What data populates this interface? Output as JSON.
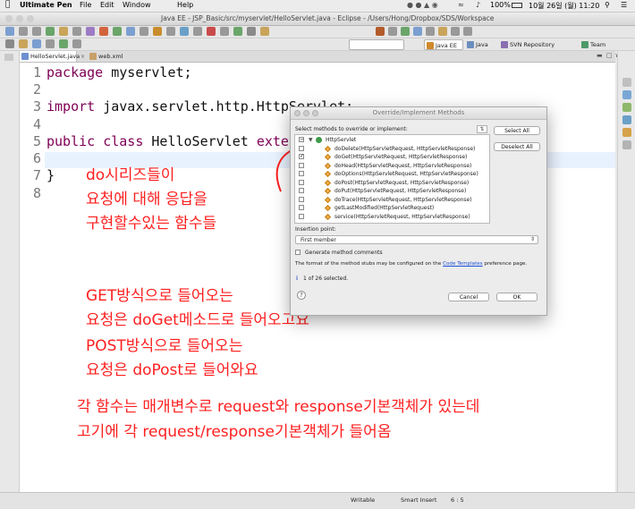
{
  "menubar": {
    "app": "Ultimate Pen",
    "items": [
      "File",
      "Edit",
      "Window",
      "Help"
    ],
    "battery": "100%",
    "clock": "10월 26일 (월) 11:20"
  },
  "window": {
    "title": "Java EE - JSP_Basic/src/myservlet/HelloServlet.java - Eclipse - /Users/Hong/Dropbox/SDS/Workspace"
  },
  "perspectives": [
    {
      "label": "Java EE",
      "color": "#d08a2c"
    },
    {
      "label": "Java",
      "color": "#6b8ebf"
    },
    {
      "label": "SVN Repository Exploring",
      "color": "#8a6fb0"
    },
    {
      "label": "Team Synchronizing",
      "color": "#4c9a6a"
    }
  ],
  "editor": {
    "tabs": [
      {
        "label": "HelloServlet.java",
        "active": true
      },
      {
        "label": "web.xml",
        "active": false
      }
    ],
    "lines": [
      {
        "num": "1",
        "text": "package myservlet;"
      },
      {
        "num": "2",
        "text": ""
      },
      {
        "num": "3",
        "text": "import javax.servlet.http.HttpServlet;"
      },
      {
        "num": "4",
        "text": ""
      },
      {
        "num": "5",
        "text": "public class HelloServlet extends HttpServlet {"
      },
      {
        "num": "6",
        "text": ""
      },
      {
        "num": "7",
        "text": "}"
      },
      {
        "num": "8",
        "text": ""
      }
    ]
  },
  "annotations": {
    "group1": [
      "do시리즈들이",
      "요청에 대해 응답을",
      "구현할수있는 함수들"
    ],
    "group2": [
      "GET방식으로 들어오는",
      "요청은 doGet메소드로 들어오고요",
      "POST방식으로 들어오는",
      "요청은 doPost로 들어와요"
    ],
    "group3": [
      "각 함수는 매개변수로 request와 response기본객체가 있는데",
      "고기에 각 request/response기본객체가 들어옴"
    ]
  },
  "dialog": {
    "title": "Override/Implement Methods",
    "prompt": "Select methods to override or implement:",
    "select_all": "Select All",
    "deselect_all": "Deselect All",
    "root": "HttpServlet",
    "methods": [
      {
        "name": "doDelete(HttpServletRequest, HttpServletResponse)",
        "checked": false
      },
      {
        "name": "doGet(HttpServletRequest, HttpServletResponse)",
        "checked": true
      },
      {
        "name": "doHead(HttpServletRequest, HttpServletResponse)",
        "checked": false
      },
      {
        "name": "doOptions(HttpServletRequest, HttpServletResponse)",
        "checked": false
      },
      {
        "name": "doPost(HttpServletRequest, HttpServletResponse)",
        "checked": false
      },
      {
        "name": "doPut(HttpServletRequest, HttpServletResponse)",
        "checked": false
      },
      {
        "name": "doTrace(HttpServletRequest, HttpServletResponse)",
        "checked": false
      },
      {
        "name": "getLastModified(HttpServletRequest)",
        "checked": false
      },
      {
        "name": "service(HttpServletRequest, HttpServletResponse)",
        "checked": false
      }
    ],
    "insertion_label": "Insertion point:",
    "insertion_value": "First member",
    "generate_comments": "Generate method comments",
    "format_prefix": "The format of the method stubs may be configured on the",
    "format_link": "Code Templates",
    "format_suffix": "preference page.",
    "selected_info": "1 of 26 selected.",
    "cancel": "Cancel",
    "ok": "OK"
  },
  "status": {
    "mode": "Writable",
    "insert": "Smart Insert",
    "position": "6 : 5"
  }
}
